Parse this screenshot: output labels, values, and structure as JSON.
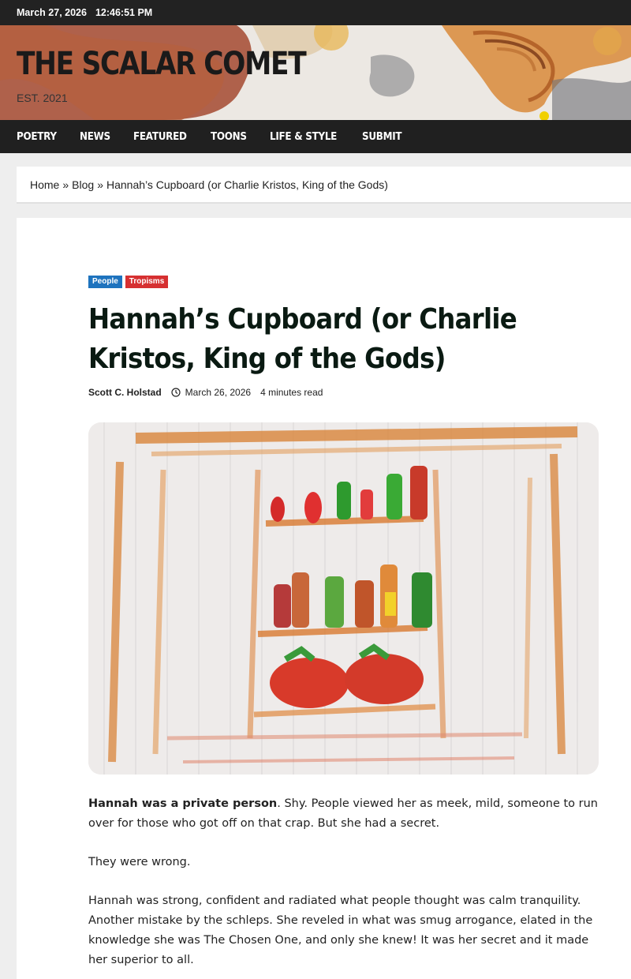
{
  "topbar": {
    "date": "March 27, 2026",
    "time": "12:46:51 PM"
  },
  "site": {
    "title": "THE SCALAR COMET",
    "tagline": "EST. 2021"
  },
  "nav": {
    "items": [
      "POETRY",
      "NEWS",
      "FEATURED",
      "TOONS",
      "LIFE & STYLE",
      "SUBMIT"
    ]
  },
  "breadcrumb": {
    "home": "Home",
    "separator": "»",
    "blog": "Blog",
    "current": "Hannah’s Cupboard (or Charlie Kristos, King of the Gods)"
  },
  "post": {
    "categories": [
      {
        "label": "People",
        "color": "#1e73be"
      },
      {
        "label": "Tropisms",
        "color": "#d63031"
      }
    ],
    "title": "Hannah’s Cupboard (or Charlie Kristos, King of the Gods)",
    "author": "Scott C. Holstad",
    "date": "March 26, 2026",
    "read_time": "4 minutes read",
    "clock_icon": "clock-icon",
    "paragraph1_bold": "Hannah was a private person",
    "paragraph1_rest": ". Shy. People viewed her as meek, mild, someone to run over for those who got off on that crap. But she had a secret.",
    "paragraph2": "They were wrong.",
    "paragraph3": "Hannah was strong, confident and radiated what people thought was calm tranquility. Another mistake by the schleps. She reveled in what was smug arrogance, elated in the knowledge she was The Chosen One, and only she knew! It was her secret and it made her superior to all."
  },
  "colors": {
    "topbar_bg": "#222222",
    "nav_bg": "#202020",
    "people": "#1e73be",
    "tropisms": "#d63031"
  }
}
